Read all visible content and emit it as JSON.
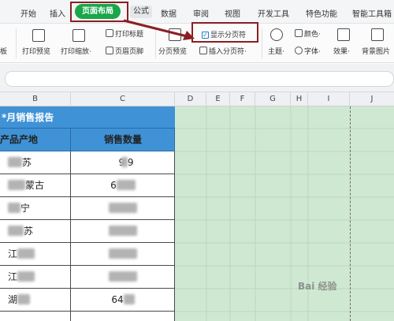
{
  "menu": {
    "tabs": [
      "开始",
      "插入",
      "页面布局",
      "公式",
      "数据",
      "审阅",
      "视图",
      "开发工具",
      "特色功能",
      "智能工具箱"
    ]
  },
  "ribbon": {
    "left_edge": "板",
    "print_preview": "打印预览",
    "print_scale": "打印缩放·",
    "print_title": "打印标题",
    "header_footer": "页眉页脚",
    "show_pagebreak": "显示分页符",
    "pagebreak_preview": "分页预览",
    "insert_pagebreak": "插入分页符·",
    "theme": "主题·",
    "color": "颜色·",
    "font": "字体·",
    "effect": "效果·",
    "background": "背景图片"
  },
  "columns": [
    "B",
    "C",
    "D",
    "E",
    "F",
    "G",
    "H",
    "I",
    "J"
  ],
  "sheet": {
    "title": "*月销售报告",
    "header_origin": "产品产地",
    "header_qty": "销售数量",
    "rows": [
      {
        "origin": "苏",
        "qty": "9  9"
      },
      {
        "origin": "蒙古",
        "qty": "6"
      },
      {
        "origin": "宁",
        "qty": ""
      },
      {
        "origin": "苏",
        "qty": ""
      },
      {
        "origin": "江",
        "qty": ""
      },
      {
        "origin": "江",
        "qty": ""
      },
      {
        "origin": "湖",
        "qty": "64"
      }
    ]
  },
  "watermark": "Bai 经验"
}
